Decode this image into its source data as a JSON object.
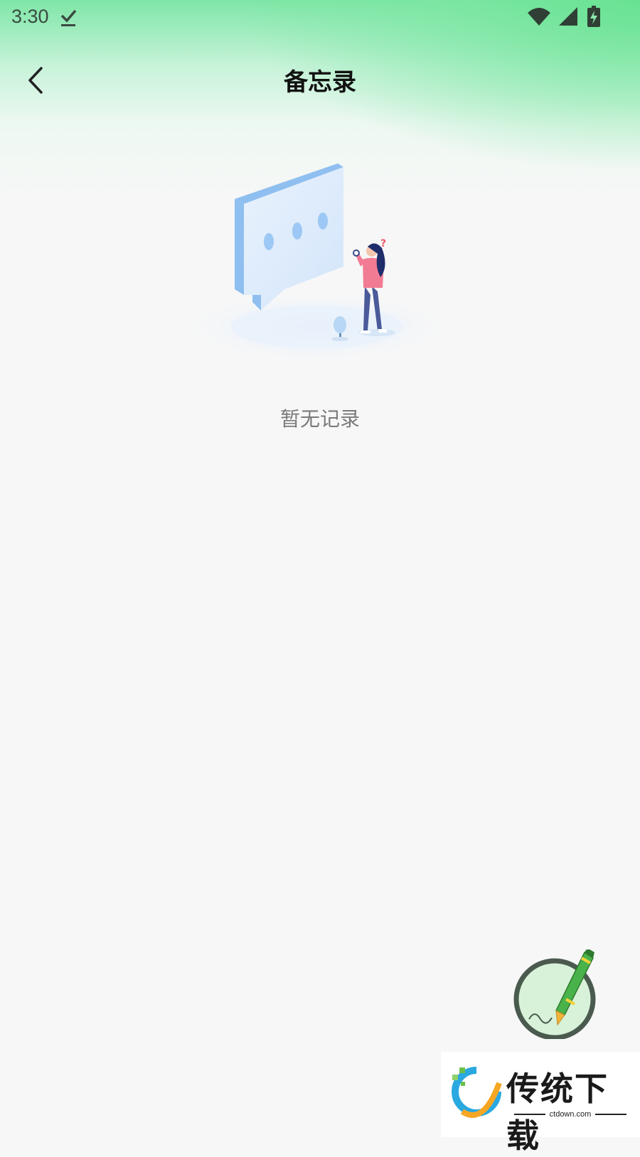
{
  "status_bar": {
    "time": "3:30",
    "icons": [
      "download-done-icon",
      "wifi-icon",
      "signal-icon",
      "battery-charging-icon"
    ]
  },
  "app_bar": {
    "title": "备忘录",
    "back_icon": "chevron-left-icon"
  },
  "empty_state": {
    "message": "暂无记录",
    "illustration": "empty-chat-illustration"
  },
  "fab": {
    "icon": "pen-icon"
  },
  "watermark": {
    "title": "传统下载",
    "subtitle": "ctdown.com"
  },
  "colors": {
    "accent_green": "#68e292",
    "background": "#f7f7f7",
    "title_text": "#111111",
    "empty_text": "#7a7a7a"
  }
}
